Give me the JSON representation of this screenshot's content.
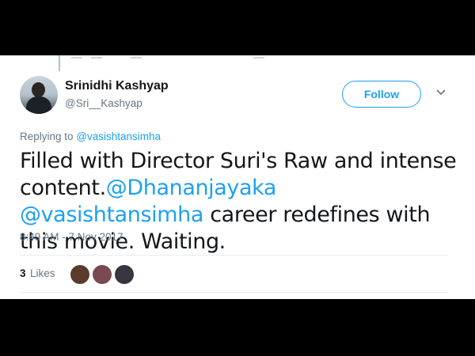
{
  "tweet": {
    "author": {
      "display_name": "Srinidhi Kashyap",
      "handle": "@Sri__Kashyap"
    },
    "follow_label": "Follow",
    "replying_prefix": "Replying to",
    "replying_to": "@vasishtansimha",
    "text_part1": "Filled with Director Suri's Raw and intense content.",
    "mention1": "@Dhananjayaka",
    "mention2": "@vasishtansimha",
    "text_part2": "career redefines with this movie. Waiting.",
    "timestamp": "8:49 AM - 7 Nov 2017",
    "likes_count": "3",
    "likes_label": "Likes",
    "likers": [
      {
        "icon": "avatar-liker-1",
        "color": "#5a3b2e"
      },
      {
        "icon": "avatar-liker-2",
        "color": "#7a4a52"
      },
      {
        "icon": "avatar-liker-3",
        "color": "#3a3440"
      }
    ]
  },
  "colors": {
    "accent": "#1da1f2",
    "text": "#14171a",
    "muted": "#657786",
    "background": "#000000"
  }
}
